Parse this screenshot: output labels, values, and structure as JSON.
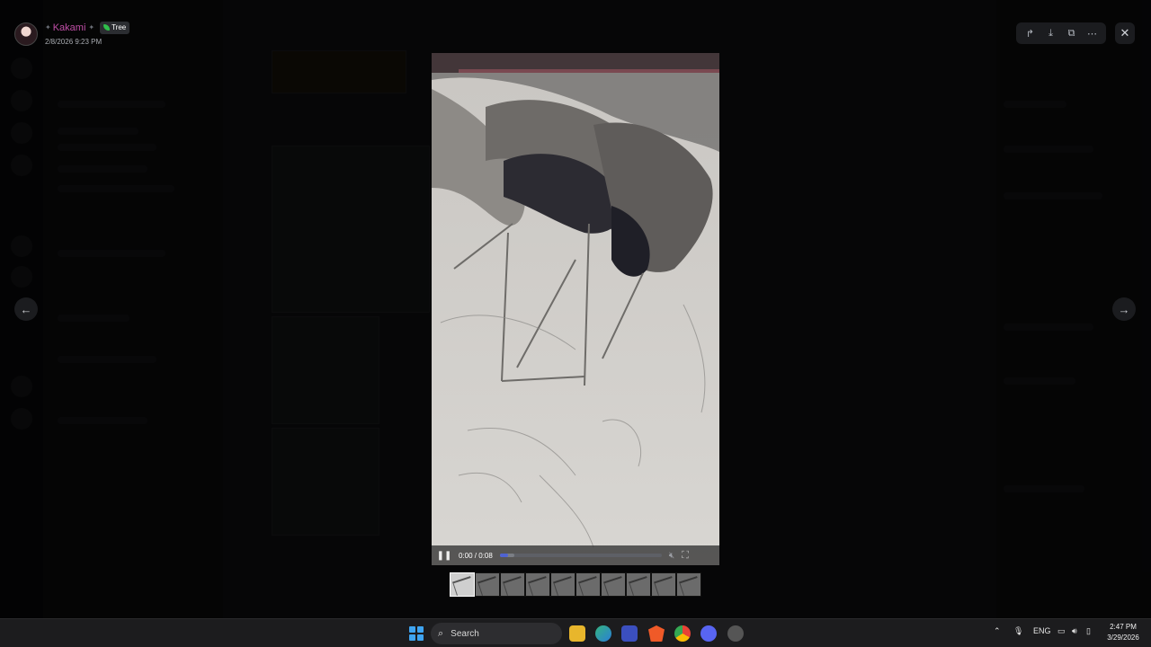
{
  "post": {
    "author": "Kakami",
    "role_badge": "Tree",
    "timestamp": "2/8/2026 9:23 PM"
  },
  "toolbar": {
    "forward_icon": "forward-icon",
    "download_icon": "download-icon",
    "open_external_icon": "open-external-icon",
    "more_icon": "more-icon",
    "close_icon": "close-icon"
  },
  "video": {
    "time_display": "0:00 / 0:08",
    "progress": 0.05
  },
  "thumbnails": {
    "count": 10,
    "active_index": 0
  },
  "taskbar": {
    "search_label": "Search",
    "language": "ENG",
    "time": "2:47 PM",
    "date": "3/29/2026"
  },
  "colors": {
    "author_name": "#c04ea6",
    "role_leaf": "#2fbf4b",
    "progress_fill": "#4f63d2",
    "start_icon": "#3fa4f0"
  }
}
